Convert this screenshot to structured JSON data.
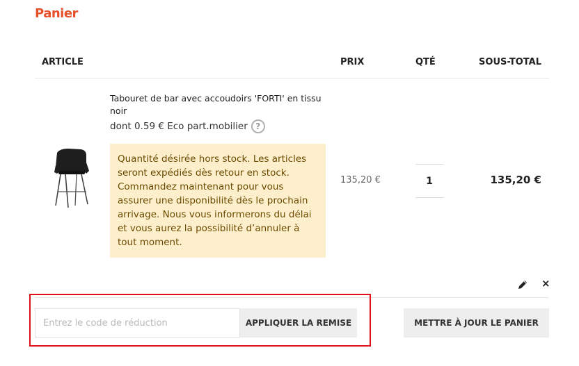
{
  "page": {
    "title": "Panier"
  },
  "table": {
    "headers": {
      "article": "ARTICLE",
      "price": "PRIX",
      "qty": "QTÉ",
      "subtotal": "SOUS-TOTAL"
    }
  },
  "item": {
    "name": "Tabouret de bar avec accoudoirs 'FORTI' en tissu noir",
    "eco_fee": "dont 0.59 € Eco part.mobilier",
    "help_icon": "?",
    "stock_notice": "Quantité désirée hors stock. Les articles seront expédiés dès retour en stock. Commandez maintenant pour vous assurer une disponibilité dès le prochain arrivage. Nous vous informerons du délai et vous aurez la possibilité d’annuler à tout moment.",
    "price": "135,20 €",
    "quantity": "1",
    "subtotal": "135,20 €"
  },
  "actions": {
    "remove": "×"
  },
  "coupon": {
    "placeholder": "Entrez le code de réduction",
    "apply_label": "APPLIQUER LA REMISE"
  },
  "update_cart_label": "METTRE À JOUR LE PANIER",
  "colors": {
    "accent": "#e8502a",
    "notice_bg": "#fdefcc",
    "highlight": "#e0101a"
  }
}
